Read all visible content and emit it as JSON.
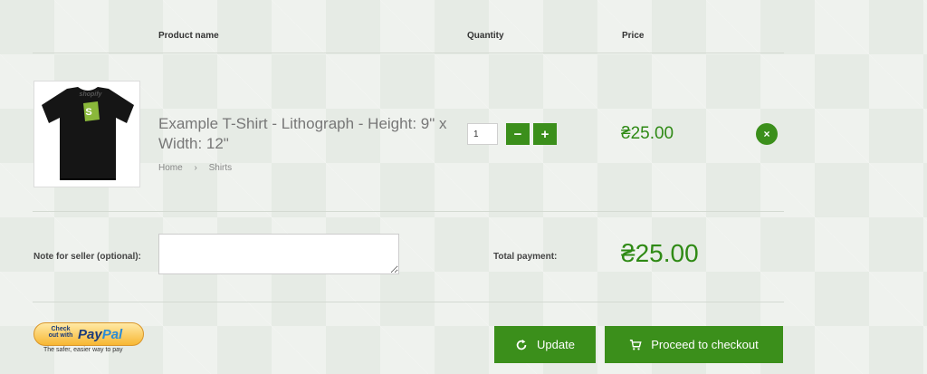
{
  "header": {
    "product_name": "Product name",
    "quantity": "Quantity",
    "price": "Price"
  },
  "item": {
    "title": "Example T-Shirt - Lithograph - Height: 9\" x Width: 12\"",
    "breadcrumb": [
      "Home",
      "Shirts"
    ],
    "breadcrumb_sep": "›",
    "image_text": "shopify",
    "quantity": "1",
    "decrement_label": "−",
    "increment_label": "+",
    "price": "₴25.00",
    "remove_label": "×"
  },
  "note": {
    "label": "Note for seller (optional):",
    "value": ""
  },
  "total": {
    "label": "Total payment:",
    "value": "₴25.00"
  },
  "paypal": {
    "checkout_text": "Check out with",
    "logo_pay": "Pay",
    "logo_pal": "Pal",
    "tagline": "The safer, easier way to pay"
  },
  "actions": {
    "update_label": "Update",
    "update_icon": "refresh-icon",
    "checkout_label": "Proceed to checkout",
    "checkout_icon": "cart-icon"
  },
  "colors": {
    "accent": "#3b8f1b",
    "price": "#2f8a15",
    "background": "#e6ebe5"
  }
}
